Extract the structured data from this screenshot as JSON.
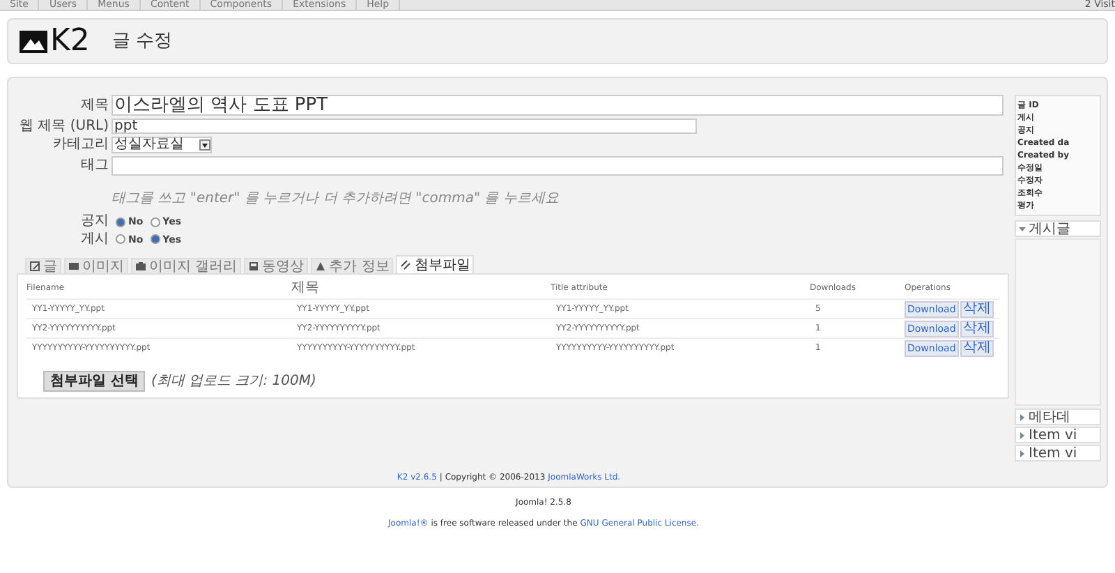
{
  "top_menu": [
    {
      "label": "Site"
    },
    {
      "label": "Users"
    },
    {
      "label": "Menus"
    },
    {
      "label": "Content"
    },
    {
      "label": "Components"
    },
    {
      "label": "Extensions"
    },
    {
      "label": "Help"
    }
  ],
  "top_right": "2 Visit",
  "header": {
    "logo": "K2",
    "title": "글 수정"
  },
  "form": {
    "title": {
      "label": "제목",
      "value": "이스라엘의 역사 도표 PPT"
    },
    "alias": {
      "label": "웹 제목 (URL)",
      "value": "ppt"
    },
    "category": {
      "label": "카테고리",
      "value": "성실자료실"
    },
    "tags": {
      "label": "태그",
      "hint": "태그를 쓰고 \"enter\" 를 누르거나 더 추가하려면 \"comma\" 를 누르세요"
    },
    "radios": [
      {
        "label": "공지",
        "options": [
          {
            "label": "No",
            "selected": true
          },
          {
            "label": "Yes",
            "selected": false
          }
        ]
      },
      {
        "label": "게시",
        "options": [
          {
            "label": "No",
            "selected": false
          },
          {
            "label": "Yes",
            "selected": true
          }
        ]
      }
    ]
  },
  "tabs": [
    {
      "label": "글",
      "selected": false
    },
    {
      "label": "이미지",
      "selected": false
    },
    {
      "label": "이미지 갤러리",
      "selected": false
    },
    {
      "label": "동영상",
      "selected": false
    },
    {
      "label": "추가 정보",
      "selected": false
    },
    {
      "label": "첨부파일",
      "selected": true
    }
  ],
  "table": {
    "columns": [
      "Filename",
      "제목",
      "Title attribute",
      "Downloads",
      "Operations"
    ],
    "rows": [
      {
        "cells": [
          "YY1-YYYYY_YY.ppt",
          "YY1-YYYYY_YY.ppt",
          "YY1-YYYYY_YY.ppt",
          "5"
        ],
        "actions": [
          "Download",
          "삭제"
        ]
      },
      {
        "cells": [
          "YY2-YYYYYYYYYY.ppt",
          "YY2-YYYYYYYYYY.ppt",
          "YY2-YYYYYYYYYY.ppt",
          "1"
        ],
        "actions": [
          "Download",
          "삭제"
        ]
      },
      {
        "cells": [
          "YYYYYYYYYY-YYYYYYYYYY.ppt",
          "YYYYYYYYYY-YYYYYYYYYY.ppt",
          "YYYYYYYYYY-YYYYYYYYYY.ppt",
          "1"
        ],
        "actions": [
          "Download",
          "삭제"
        ]
      }
    ]
  },
  "attach_button": "첨부파일 선택",
  "attach_note": "(최대 업로드 크기: 100M)",
  "info_panel": {
    "items": [
      "글 ID",
      "게시",
      "공지",
      "Created da",
      "Created by",
      "수정일",
      "수정자",
      "조회수",
      "평가"
    ]
  },
  "side_sections": [
    {
      "label": "게시글",
      "expanded": true
    },
    {
      "label": "메타데",
      "expanded": false
    },
    {
      "label": "Item vi",
      "expanded": false
    },
    {
      "label": "Item vi",
      "expanded": false
    }
  ],
  "credits": {
    "version": "K2 v2.6.5",
    "text": "| Copyright © 2006-2013",
    "company": "JoomlaWorks Ltd."
  },
  "footer": {
    "version": "Joomla! 2.5.8",
    "product": "Joomla!®",
    "text": "is free software released under the",
    "license": "GNU General Public License."
  }
}
